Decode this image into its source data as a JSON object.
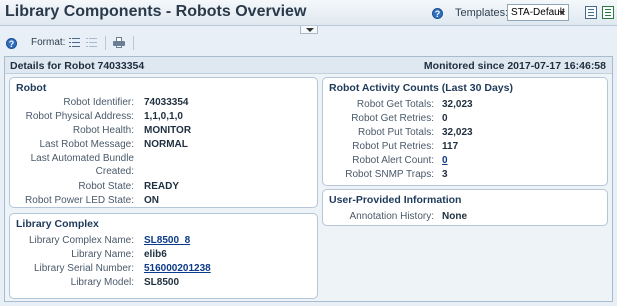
{
  "header": {
    "title": "Library Components - Robots Overview",
    "templates_label": "Templates:",
    "templates_value": "STA-Default"
  },
  "toolbar": {
    "format_label": "Format:"
  },
  "panel": {
    "details_title": "Details for Robot 74033354",
    "monitored": "Monitored since 2017-07-17 16:46:58"
  },
  "robot": {
    "title": "Robot",
    "rows": [
      {
        "label": "Robot Identifier:",
        "value": "74033354"
      },
      {
        "label": "Robot Physical Address:",
        "value": "1,1,0,1,0"
      },
      {
        "label": "Robot Health:",
        "value": "MONITOR"
      },
      {
        "label": "Last Robot Message:",
        "value": "NORMAL"
      },
      {
        "label": "Last Automated Bundle",
        "value": ""
      },
      {
        "label": "Created:",
        "value": ""
      },
      {
        "label": "Robot State:",
        "value": "READY"
      },
      {
        "label": "Robot Power LED State:",
        "value": "ON"
      }
    ]
  },
  "library_complex": {
    "title": "Library Complex",
    "rows": [
      {
        "label": "Library Complex Name:",
        "value": "SL8500_8"
      },
      {
        "label": "Library Name:",
        "value": "elib6"
      },
      {
        "label": "Library Serial Number:",
        "value": "516000201238"
      },
      {
        "label": "Library Model:",
        "value": "SL8500"
      }
    ]
  },
  "activity": {
    "title": "Robot Activity Counts (Last 30 Days)",
    "rows": [
      {
        "label": "Robot Get Totals:",
        "value": "32,023"
      },
      {
        "label": "Robot Get Retries:",
        "value": "0"
      },
      {
        "label": "Robot Put Totals:",
        "value": "32,023"
      },
      {
        "label": "Robot Put Retries:",
        "value": "117"
      },
      {
        "label": "Robot Alert Count:",
        "value": "0"
      },
      {
        "label": "Robot SNMP Traps:",
        "value": "3"
      }
    ]
  },
  "user_info": {
    "title": "User-Provided Information",
    "rows": [
      {
        "label": "Annotation History:",
        "value": "None"
      }
    ]
  }
}
